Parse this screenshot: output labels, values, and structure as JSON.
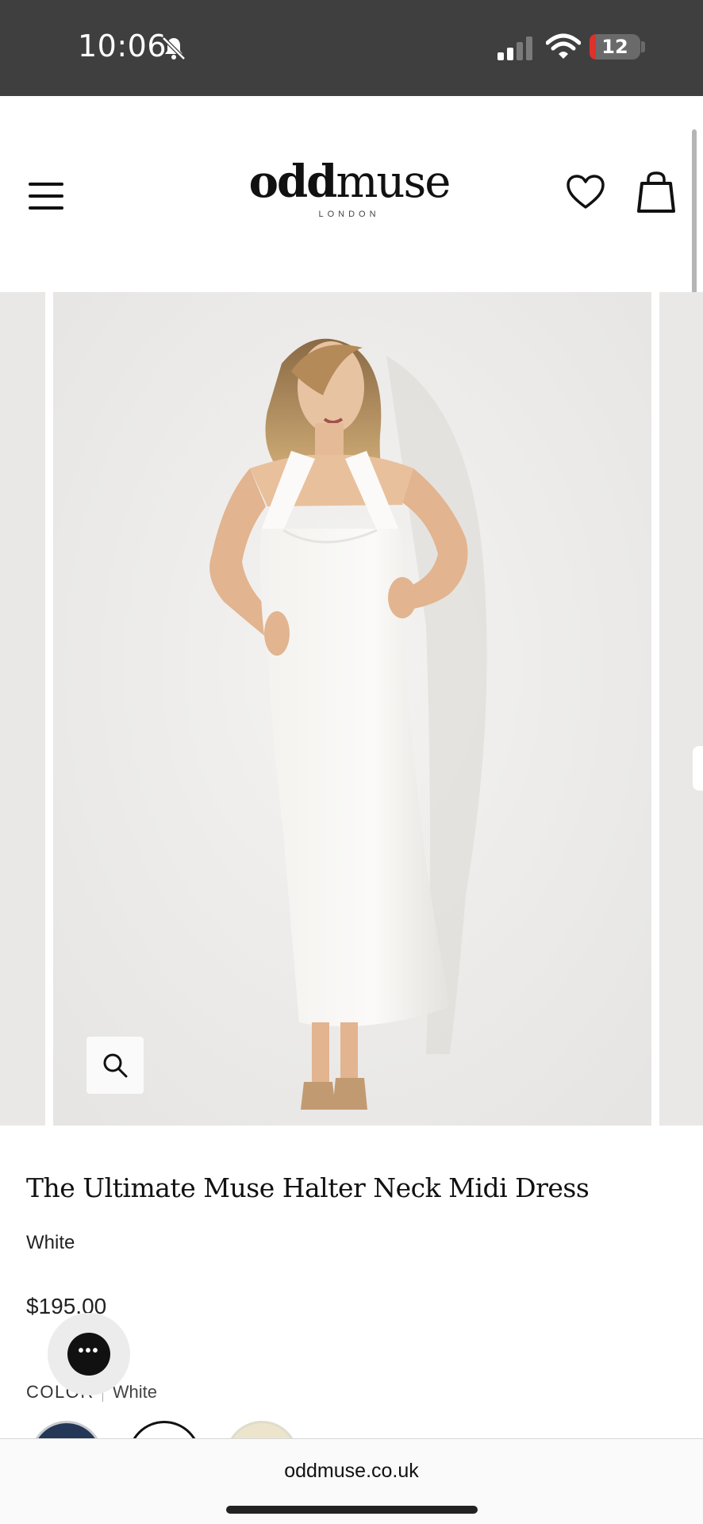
{
  "status_bar": {
    "time": "10:06",
    "battery": "12",
    "battery_level": 0.12,
    "icons": [
      "bell-slash-icon",
      "signal-icon",
      "wifi-icon",
      "battery-icon"
    ]
  },
  "header": {
    "logo_main": "oddmuse",
    "logo_sub": "LONDON",
    "icons": [
      "menu-icon",
      "heart-icon",
      "bag-icon"
    ]
  },
  "gallery": {
    "zoom_icon": "magnifier-icon"
  },
  "product": {
    "title": "The Ultimate Muse Halter Neck Midi Dress",
    "variant": "White",
    "price": "$195.00",
    "color_label": "COLOR",
    "color_value": "White",
    "swatches": [
      {
        "name": "navy",
        "color": "#243756"
      },
      {
        "name": "white",
        "color": "#ffffff",
        "selected": true
      },
      {
        "name": "cream",
        "color": "#ece5cc"
      }
    ]
  },
  "chat": {
    "icon": "chat-dots-icon"
  },
  "browser": {
    "url": "oddmuse.co.uk"
  }
}
